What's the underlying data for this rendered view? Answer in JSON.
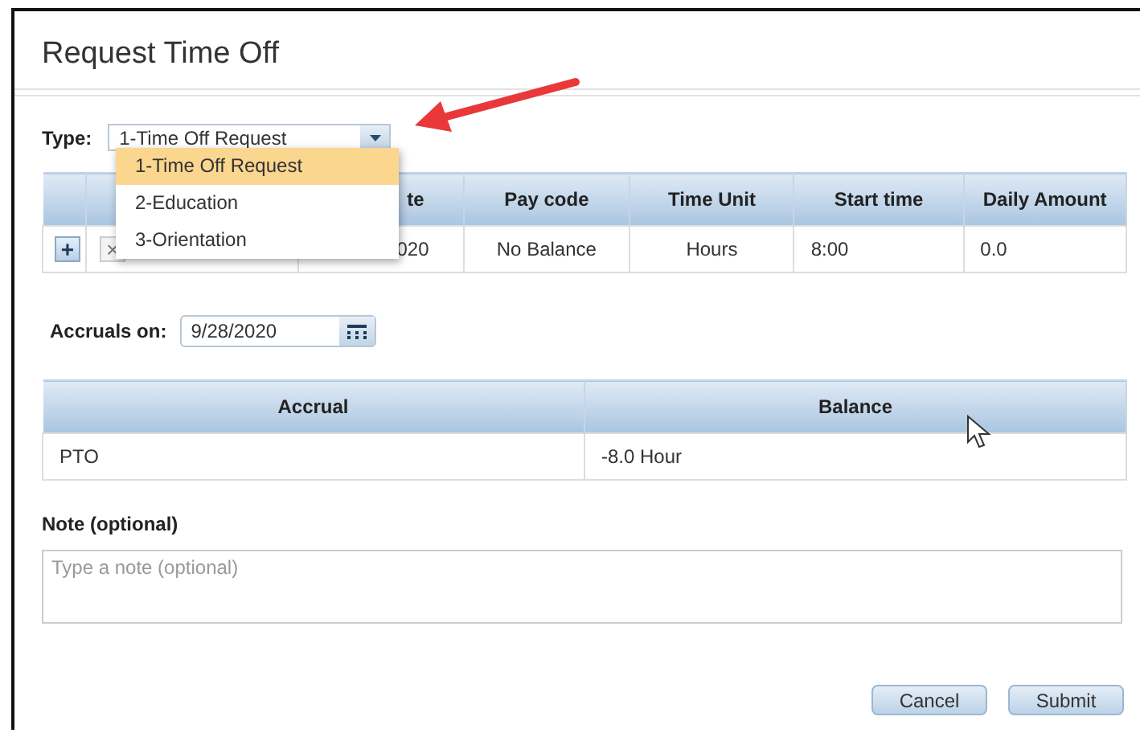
{
  "dialog": {
    "title": "Request Time Off"
  },
  "type_field": {
    "label": "Type:",
    "value": "1-Time Off Request",
    "dropdown": {
      "open": true,
      "options": [
        {
          "label": "1-Time Off Request",
          "selected": true
        },
        {
          "label": "2-Education",
          "selected": false
        },
        {
          "label": "3-Orientation",
          "selected": false
        }
      ]
    }
  },
  "request_table": {
    "add_label": "+",
    "remove_label": "×",
    "remove_disabled": true,
    "columns": [
      "te",
      "Pay code",
      "Time Unit",
      "Start time",
      "Daily Amount"
    ],
    "rows": [
      {
        "cells": [
          "020",
          "No Balance",
          "Hours",
          "8:00",
          "0.0"
        ]
      }
    ]
  },
  "accruals": {
    "label": "Accruals on:",
    "date": "9/28/2020",
    "columns": [
      "Accrual",
      "Balance"
    ],
    "rows": [
      {
        "cells": [
          "PTO",
          "-8.0 Hour"
        ]
      }
    ]
  },
  "note": {
    "label": "Note (optional)",
    "placeholder": "Type a note (optional)"
  },
  "buttons": [
    "Cancel",
    "Submit"
  ]
}
